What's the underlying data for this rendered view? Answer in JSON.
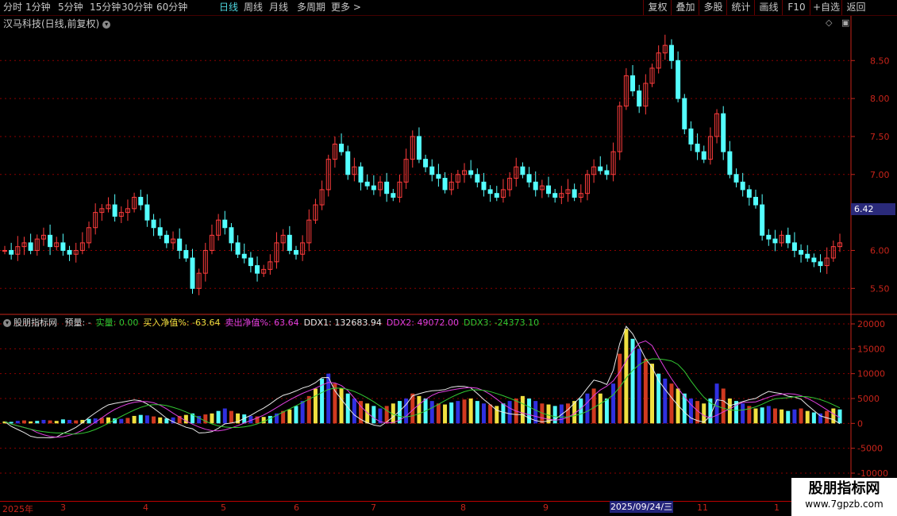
{
  "topbar": {
    "periods": [
      "分时",
      "1分钟",
      "5分钟",
      "15分钟",
      "30分钟",
      "60分钟",
      "日线",
      "周线",
      "月线",
      "多周期",
      "更多 >"
    ],
    "active_period": "日线",
    "right_buttons": [
      "复权",
      "叠加",
      "多股",
      "统计",
      "画线",
      "F10",
      "+自选",
      "返回"
    ]
  },
  "chart_title": "汉马科技(日线,前复权)",
  "indicator_line": {
    "name": "股朋指标网",
    "items": [
      {
        "text": "预量: -",
        "color": "#d8d8d8"
      },
      {
        "text": "实量: 0.00",
        "color": "#32c832"
      },
      {
        "text": "买入净值%: -63.64",
        "color": "#f0e040"
      },
      {
        "text": "卖出净值%: 63.64",
        "color": "#e040e0"
      },
      {
        "text": "DDX1: 132683.94",
        "color": "#e8e8e8"
      },
      {
        "text": "DDX2: 49072.00",
        "color": "#e040e0"
      },
      {
        "text": "DDX3: -24373.10",
        "color": "#32c832"
      }
    ]
  },
  "price_axis": [
    "8.50",
    "8.00",
    "7.50",
    "7.00",
    "6.00",
    "5.50"
  ],
  "current_price_tag": "6.42",
  "indicator_axis": [
    "20000",
    "15000",
    "10000",
    "5000",
    "0",
    "-5000",
    "-10000"
  ],
  "date_axis": [
    "2025年",
    "3",
    "4",
    "5",
    "6",
    "7",
    "8",
    "9",
    "11",
    "1"
  ],
  "selected_date": "2025/09/24/三",
  "watermark": {
    "title": "股朋指标网",
    "url": "www.7gpzb.com"
  },
  "colors": {
    "up": "#ff3c3c",
    "down": "#54ffff",
    "grid": "#8b0000",
    "axis": "#c8241a"
  },
  "chart_data": [
    {
      "type": "candlestick",
      "title": "汉马科技(日线,前复权)",
      "ylim": [
        5.2,
        8.9
      ],
      "close": [
        6.0,
        5.95,
        6.05,
        6.1,
        6.0,
        6.15,
        6.2,
        6.05,
        6.1,
        6.0,
        5.95,
        6.0,
        6.1,
        6.3,
        6.5,
        6.55,
        6.6,
        6.45,
        6.5,
        6.55,
        6.7,
        6.6,
        6.4,
        6.3,
        6.2,
        6.1,
        6.15,
        6.0,
        5.9,
        5.5,
        5.7,
        6.0,
        6.2,
        6.4,
        6.3,
        6.1,
        5.95,
        5.9,
        5.8,
        5.7,
        5.75,
        5.85,
        6.1,
        6.2,
        6.0,
        5.95,
        6.1,
        6.4,
        6.6,
        6.8,
        7.2,
        7.4,
        7.3,
        7.0,
        7.1,
        6.9,
        6.85,
        6.8,
        6.9,
        6.75,
        6.7,
        6.9,
        7.2,
        7.5,
        7.2,
        7.1,
        7.0,
        6.95,
        6.8,
        6.9,
        7.0,
        7.05,
        7.0,
        6.9,
        6.8,
        6.75,
        6.7,
        6.8,
        6.95,
        7.1,
        7.0,
        6.9,
        6.8,
        6.85,
        6.75,
        6.7,
        6.75,
        6.8,
        6.7,
        6.75,
        7.0,
        7.1,
        7.05,
        7.0,
        7.3,
        7.9,
        8.3,
        8.1,
        7.9,
        8.2,
        8.4,
        8.6,
        8.7,
        8.5,
        8.0,
        7.6,
        7.4,
        7.3,
        7.2,
        7.5,
        7.8,
        7.3,
        7.0,
        6.9,
        6.8,
        6.7,
        6.6,
        6.2,
        6.15,
        6.1,
        6.2,
        6.1,
        6.0,
        5.95,
        5.9,
        5.85,
        5.8,
        5.9,
        6.05,
        6.1
      ],
      "highlighted_ylabel": "6.42"
    },
    {
      "type": "bar",
      "title": "股朋指标网",
      "ylim": [
        -10000,
        20000
      ],
      "series": [
        {
          "name": "DDX1",
          "color": "#e8e8e8"
        },
        {
          "name": "DDX2",
          "color": "#e040e0"
        },
        {
          "name": "DDX3",
          "color": "#32c832"
        }
      ],
      "values": [
        400,
        300,
        500,
        600,
        400,
        500,
        700,
        600,
        500,
        800,
        700,
        600,
        700,
        900,
        1000,
        1100,
        1200,
        1000,
        900,
        1100,
        1500,
        1700,
        1600,
        1400,
        1200,
        1000,
        1200,
        1500,
        1700,
        2000,
        1500,
        1800,
        2000,
        2500,
        3000,
        2500,
        2000,
        1800,
        1500,
        1400,
        1300,
        1500,
        2000,
        2500,
        2800,
        3500,
        4500,
        5500,
        7000,
        9000,
        10000,
        8000,
        7000,
        6000,
        5000,
        4500,
        4000,
        3500,
        3000,
        3500,
        4000,
        4500,
        5000,
        6000,
        5500,
        5000,
        4500,
        4000,
        3800,
        4200,
        4500,
        4800,
        5000,
        4500,
        4000,
        3800,
        3500,
        4000,
        4500,
        5000,
        5500,
        5000,
        4500,
        4000,
        3800,
        3500,
        3800,
        4000,
        4500,
        5000,
        6000,
        7000,
        6000,
        5000,
        8000,
        14000,
        19000,
        17000,
        15000,
        13000,
        12000,
        10000,
        9000,
        8000,
        7000,
        6000,
        5000,
        4500,
        4000,
        5000,
        8000,
        7000,
        5000,
        4500,
        4000,
        3500,
        3000,
        3200,
        3500,
        3000,
        2800,
        2500,
        2800,
        3000,
        2500,
        2200,
        2000,
        2500,
        3000,
        2800
      ]
    }
  ]
}
